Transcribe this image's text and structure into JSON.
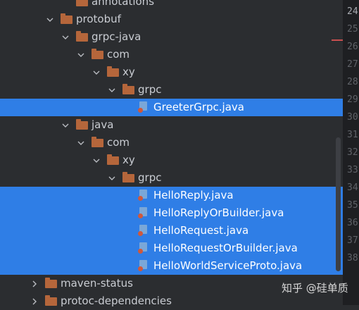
{
  "tree": [
    {
      "label": "annotations",
      "type": "folder",
      "depth": 4,
      "expanded": null,
      "selected": false
    },
    {
      "label": "protobuf",
      "type": "folder",
      "depth": 3,
      "expanded": true,
      "selected": false
    },
    {
      "label": "grpc-java",
      "type": "folder",
      "depth": 4,
      "expanded": true,
      "selected": false
    },
    {
      "label": "com",
      "type": "folder",
      "depth": 5,
      "expanded": true,
      "selected": false
    },
    {
      "label": "xy",
      "type": "folder",
      "depth": 6,
      "expanded": true,
      "selected": false
    },
    {
      "label": "grpc",
      "type": "folder",
      "depth": 7,
      "expanded": true,
      "selected": false
    },
    {
      "label": "GreeterGrpc.java",
      "type": "java",
      "depth": 8,
      "expanded": null,
      "selected": true
    },
    {
      "label": "java",
      "type": "folder",
      "depth": 4,
      "expanded": true,
      "selected": false
    },
    {
      "label": "com",
      "type": "folder",
      "depth": 5,
      "expanded": true,
      "selected": false
    },
    {
      "label": "xy",
      "type": "folder",
      "depth": 6,
      "expanded": true,
      "selected": false
    },
    {
      "label": "grpc",
      "type": "folder",
      "depth": 7,
      "expanded": true,
      "selected": false
    },
    {
      "label": "HelloReply.java",
      "type": "java",
      "depth": 8,
      "expanded": null,
      "selected": true
    },
    {
      "label": "HelloReplyOrBuilder.java",
      "type": "java",
      "depth": 8,
      "expanded": null,
      "selected": true
    },
    {
      "label": "HelloRequest.java",
      "type": "java",
      "depth": 8,
      "expanded": null,
      "selected": true
    },
    {
      "label": "HelloRequestOrBuilder.java",
      "type": "java",
      "depth": 8,
      "expanded": null,
      "selected": true
    },
    {
      "label": "HelloWorldServiceProto.java",
      "type": "java",
      "depth": 8,
      "expanded": null,
      "selected": true
    },
    {
      "label": "maven-status",
      "type": "folder",
      "depth": 2,
      "expanded": false,
      "selected": false
    },
    {
      "label": "protoc-dependencies",
      "type": "folder",
      "depth": 2,
      "expanded": false,
      "selected": false
    }
  ],
  "line_numbers": [
    "24",
    "25",
    "26",
    "27",
    "28",
    "29",
    "30",
    "31",
    "32",
    "33",
    "34",
    "35",
    "36",
    "37",
    "38"
  ],
  "current_line": "24",
  "watermark": "知乎 @硅单质",
  "colors": {
    "background": "#2b2d30",
    "selection": "#2f7ee6",
    "folder": "#b5663b",
    "java_file": "#7aa7d8"
  }
}
